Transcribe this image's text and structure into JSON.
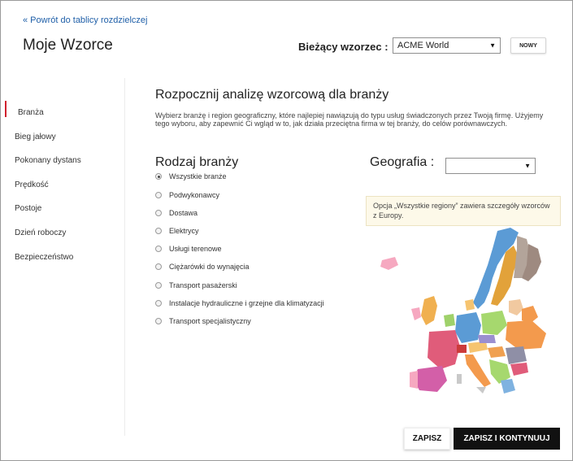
{
  "header": {
    "back_link": "« Powrót do tablicy rozdzielczej",
    "title": "Moje Wzorce",
    "current_template_label": "Bieżący wzorzec :",
    "current_template_value": "ACME World",
    "new_button": "NOWY"
  },
  "sidebar": {
    "items": [
      {
        "label": "Branża",
        "active": true
      },
      {
        "label": "Bieg jałowy",
        "active": false
      },
      {
        "label": "Pokonany dystans",
        "active": false
      },
      {
        "label": "Prędkość",
        "active": false
      },
      {
        "label": "Postoje",
        "active": false
      },
      {
        "label": "Dzień roboczy",
        "active": false
      },
      {
        "label": "Bezpieczeństwo",
        "active": false
      }
    ],
    "active_color": "#d0202e"
  },
  "main": {
    "heading": "Rozpocznij analizę wzorcową dla branży",
    "intro": "Wybierz branżę i region geograficzny, które najlepiej nawiązują do typu usług świadczonych przez Twoją firmę. Użyjemy tego wyboru, aby zapewnić Ci wgląd w to, jak działa przeciętna firma w tej branży, do celów porównawczych.",
    "industry": {
      "title": "Rodzaj branży",
      "options": [
        {
          "label": "Wszystkie branże",
          "checked": true
        },
        {
          "label": "Podwykonawcy",
          "checked": false
        },
        {
          "label": "Dostawa",
          "checked": false
        },
        {
          "label": "Elektrycy",
          "checked": false
        },
        {
          "label": "Usługi terenowe",
          "checked": false
        },
        {
          "label": "Ciężarówki do wynajęcia",
          "checked": false
        },
        {
          "label": "Transport pasażerski",
          "checked": false
        },
        {
          "label": "Instalacje hydrauliczne i grzejne dla klimatyzacji",
          "checked": false
        },
        {
          "label": "Transport specjalistyczny",
          "checked": false
        }
      ]
    },
    "geography": {
      "title": "Geografia :",
      "selected_value": "",
      "note": "Opcja „Wszystkie regiony” zawiera szczegóły wzorców z Europy.",
      "map_icon": "europe-map"
    }
  },
  "footer": {
    "save_button": "ZAPISZ",
    "save_continue_button": "ZAPISZ I KONTYNUUJ"
  }
}
